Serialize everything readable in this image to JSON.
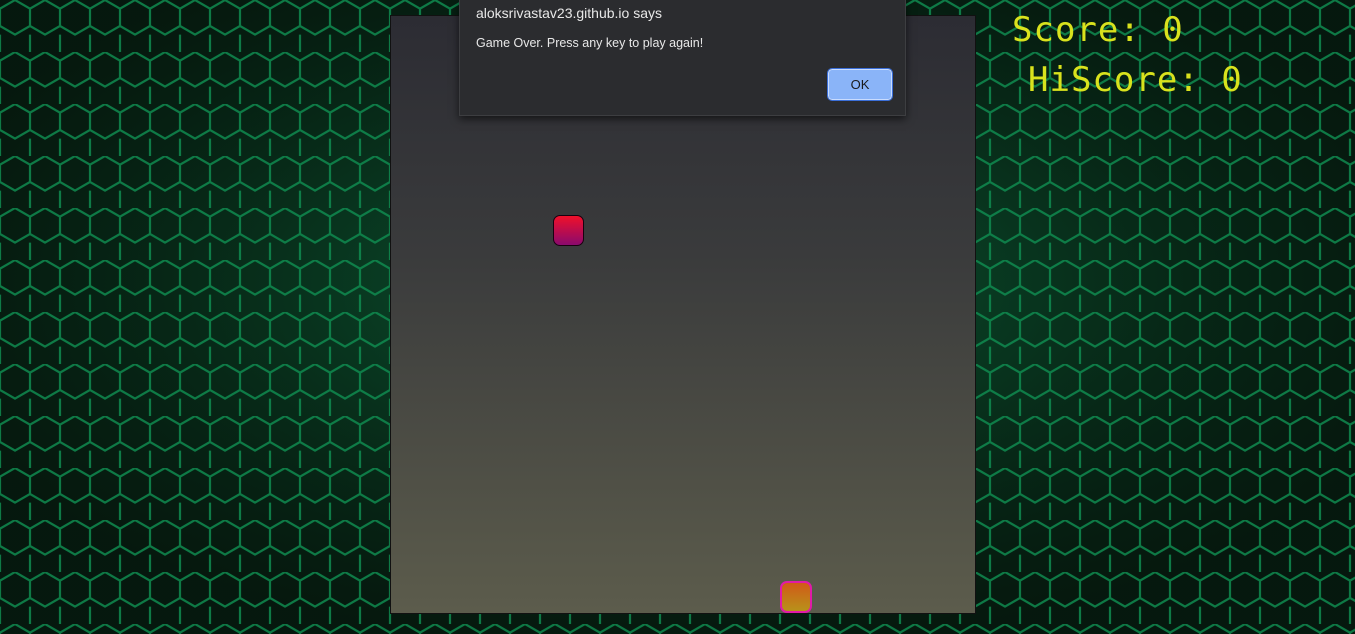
{
  "dialog": {
    "origin": "aloksrivastav23.github.io says",
    "message": "Game Over. Press any key to play again!",
    "ok_label": "OK"
  },
  "scoreboard": {
    "score_label": "Score: 0",
    "hiscore_label": "HiScore: 0",
    "score": 0,
    "hiscore": 0
  },
  "colors": {
    "score_text": "#d9e21d",
    "background_hex": "#0a5a35",
    "board_top": "#2c2c33",
    "board_bottom": "#5c5c4c",
    "food": "#f0102a",
    "snake_head_border": "#e11aa8",
    "ok_button": "#8ab4f8"
  }
}
